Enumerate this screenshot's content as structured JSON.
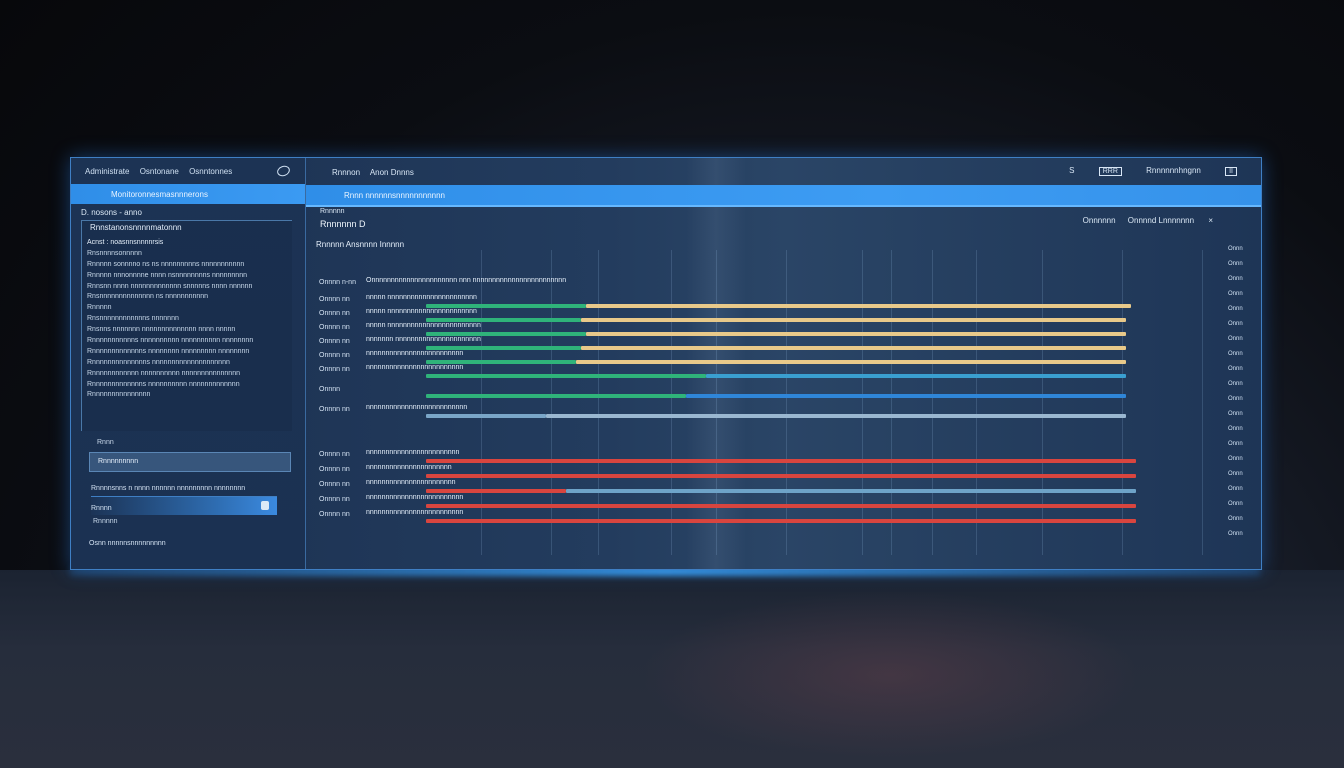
{
  "left_panel": {
    "tabs": [
      "Administrate",
      "Osntonane",
      "Osnntonnes"
    ],
    "bar_label": "Monitoronnesmasnnnerons",
    "subhead": "D. nosons - anno",
    "box_title": "Rnnstanonsnnnnmatonnn",
    "list": [
      {
        "text": "Acnst : noasnnsnnnnrsis",
        "head": true
      },
      {
        "text": "Rnsnnnnsonnnnn",
        "head": false
      },
      {
        "text": "Rnnnnn sonnnno ns ns nnnnnnnnns nnnnnnnnnnn",
        "head": false
      },
      {
        "text": "Rnnnnn nnnonnnne nnnn nsnnnnnnnns nnnnnnnnn",
        "head": false
      },
      {
        "text": "Rnnsnn nnnn nnnnnnnnnnnnn snnnnns nnnn nnnnnn",
        "head": false
      },
      {
        "text": "Rnsnnnnnnnnnnnnnn ns nnnnnnnnnnn",
        "head": false
      },
      {
        "text": "Rnnnnn",
        "head": false
      },
      {
        "text": "Rnsnnnnnnnnnnnns nnnnnnn",
        "head": false
      },
      {
        "text": "Rnsnns nnnnnnn nnnnnnnnnnnnnn nnnn nnnnn",
        "head": false
      },
      {
        "text": "Rnnnnnnnnnnns nnnnnnnnnn nnnnnnnnnn nnnnnnnn",
        "head": false
      },
      {
        "text": "Rnnnnnnnnnnnnns nnnnnnnn nnnnnnnnn nnnnnnnn",
        "head": false
      },
      {
        "text": "Rnnnnnnnnnnnnnns nnnnnnnnnnnnnnnnnnnn",
        "head": false
      },
      {
        "text": "Rnnnnnnnnnnnn nnnnnnnnnn nnnnnnnnnnnnnnn",
        "head": false
      },
      {
        "text": "Rnnnnnnnnnnnnns nnnnnnnnnn nnnnnnnnnnnnn",
        "head": false
      },
      {
        "text": "Rnnnnnnnnnnnnnnn",
        "head": false
      }
    ],
    "item_a": "Rnnn",
    "selected_item": "Rnnnnnnnnn",
    "path": "Rnnnnsnns n nnnn nnnnnn nnnnnnnnn nnnnnnnn",
    "stat1": "Rnnnn",
    "stat2": "Rnnnnn",
    "footer": "Osnn nnnnnsnnnnnnnnn"
  },
  "main": {
    "crumbs": [
      "Rnnnon",
      "Anon Dnnns"
    ],
    "header_icons": {
      "settings": "S",
      "badge": "RRR",
      "account": "Rnnnnnnhngnn",
      "window": "II"
    },
    "bar_label": "Rnnn nnnnnnsnnnnnnnnnnn",
    "title_small": "Rnnnnn",
    "title": "Rnnnnnn D",
    "legend": [
      "Onnnnnn",
      "Onnnnd Lnnnnnnn"
    ],
    "legend_close": "×",
    "section": "Rnnnnn Ansnnnn Innnnn",
    "rows": [
      {
        "label": "Onnnn n-nn",
        "text": "Onnnnnnnnnnnnnnnnnnnnnn nnn nnnnnnnnnnnnnnnnnnnnnnnn"
      },
      {
        "label": "Onnnn nn",
        "text": "nnnnn nnnnnnnnnnnnnnnnnnnnnnn"
      },
      {
        "label": "Onnnn nn",
        "text": "nnnnn nnnnnnnnnnnnnnnnnnnnnnn"
      },
      {
        "label": "Onnnn nn",
        "text": "nnnnn nnnnnnnnnnnnnnnnnnnnnnnn"
      },
      {
        "label": "Onnnn nn",
        "text": "nnnnnnn nnnnnnnnnnnnnnnnnnnnnn"
      },
      {
        "label": "Onnnn nn",
        "text": "nnnnnnnnnnnnnnnnnnnnnnnnn"
      },
      {
        "label": "Onnnn nn",
        "text": "nnnnnnnnnnnnnnnnnnnnnnnnn"
      },
      {
        "label": "Onnnn",
        "text": ""
      },
      {
        "label": "Onnnn nn",
        "text": "nnnnnnnnnnnnnnnnnnnnnnnnnn"
      },
      {
        "label": "Onnnn nn",
        "text": "nnnnnnnnnnnnnnnnnnnnnnnn"
      },
      {
        "label": "Onnnn nn",
        "text": "nnnnnnnnnnnnnnnnnnnnnn"
      },
      {
        "label": "Onnnn nn",
        "text": "nnnnnnnnnnnnnnnnnnnnnnn"
      },
      {
        "label": "Onnnn nn",
        "text": "nnnnnnnnnnnnnnnnnnnnnnnnn"
      },
      {
        "label": "Onnnn nn",
        "text": "nnnnnnnnnnnnnnnnnnnnnnnnn"
      }
    ],
    "right_scale": [
      "Onnn",
      "Onnn",
      "Onnn",
      "Onnn",
      "Onnn",
      "Onnn",
      "Onnn",
      "Onnn",
      "Onnn",
      "Onnn",
      "Onnn",
      "Onnn",
      "Onnn",
      "Onnn",
      "Onnn",
      "Onnn",
      "Onnn",
      "Onnn",
      "Onnn",
      "Onnn"
    ]
  },
  "colors": {
    "accent": "#3b9af2",
    "bar_gold": "#e8c98a",
    "bar_green": "#2fb37a",
    "bar_blue": "#2f86d8",
    "bar_red": "#d8453f"
  }
}
